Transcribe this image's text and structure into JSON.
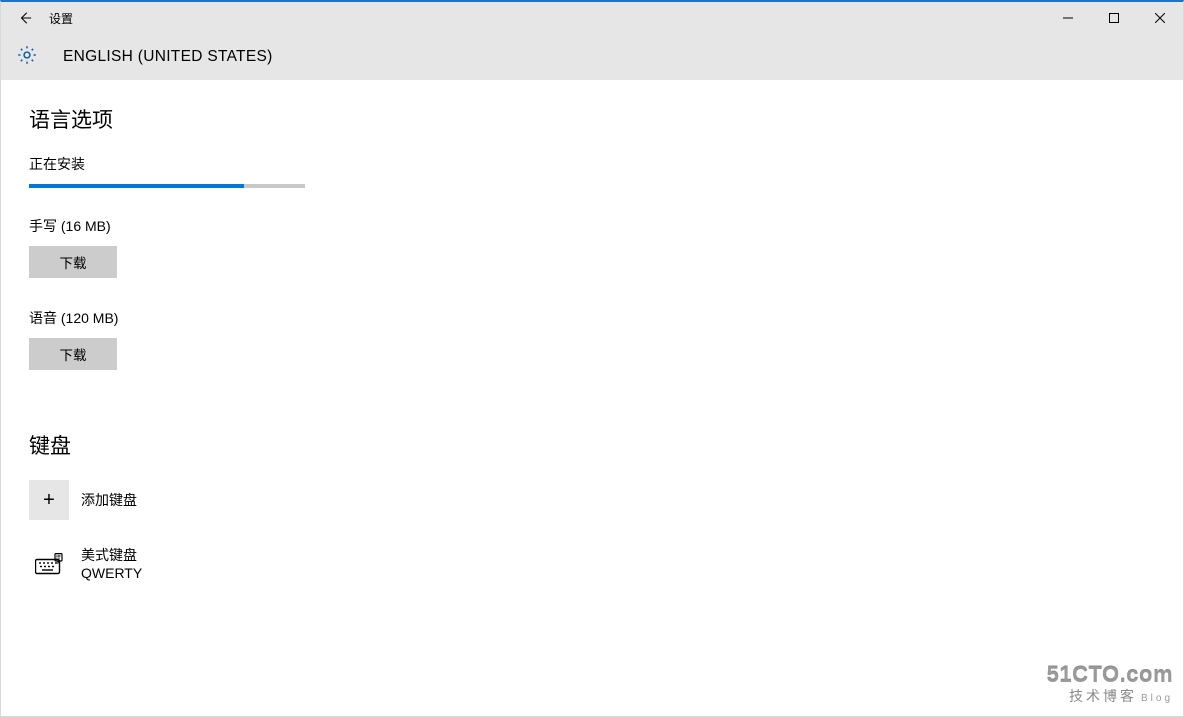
{
  "window": {
    "title": "设置"
  },
  "header": {
    "language": "ENGLISH (UNITED STATES)"
  },
  "sections": {
    "language_options": {
      "title": "语言选项",
      "status": "正在安装",
      "progress_percent": 78,
      "features": {
        "handwriting": {
          "label": "手写 (16 MB)",
          "button": "下载"
        },
        "speech": {
          "label": "语音 (120 MB)",
          "button": "下载"
        }
      }
    },
    "keyboard": {
      "title": "键盘",
      "add_label": "添加键盘",
      "items": [
        {
          "name": "美式键盘",
          "layout": "QWERTY"
        }
      ]
    }
  },
  "watermark": {
    "line1": "51CTO.com",
    "line2": "技术博客",
    "blog": "Blog"
  },
  "colors": {
    "accent": "#0078d7",
    "header_bg": "#e6e6e6",
    "button_bg": "#cccccc"
  }
}
